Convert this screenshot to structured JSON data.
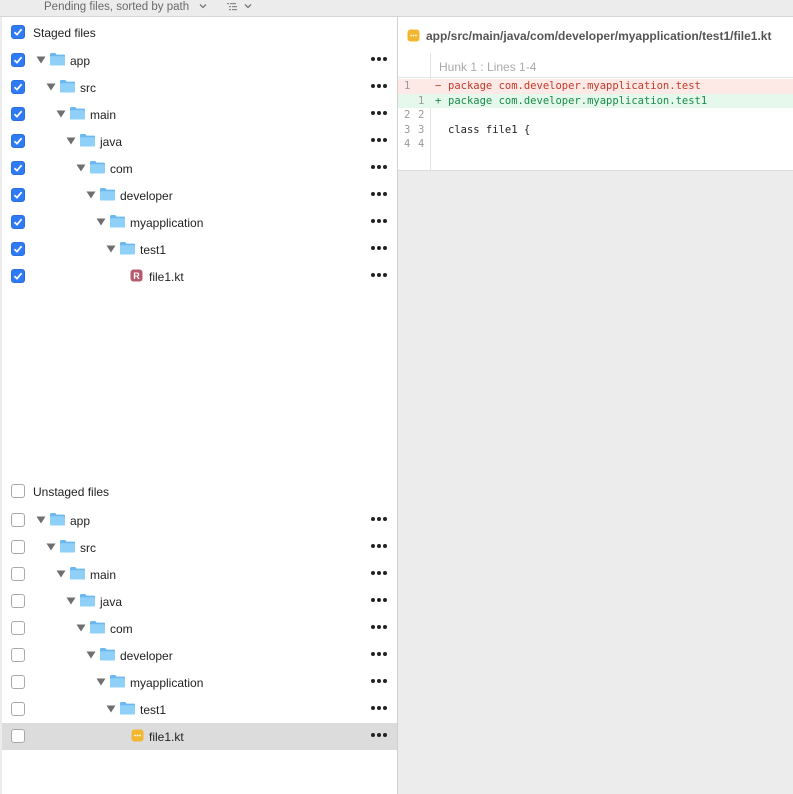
{
  "toolbar": {
    "title": "Pending files, sorted by path"
  },
  "staged": {
    "header": "Staged files",
    "checked": true,
    "rows": [
      {
        "name": "app",
        "type": "folder"
      },
      {
        "name": "src",
        "type": "folder"
      },
      {
        "name": "main",
        "type": "folder"
      },
      {
        "name": "java",
        "type": "folder"
      },
      {
        "name": "com",
        "type": "folder"
      },
      {
        "name": "developer",
        "type": "folder"
      },
      {
        "name": "myapplication",
        "type": "folder"
      },
      {
        "name": "test1",
        "type": "folder"
      },
      {
        "name": "file1.kt",
        "type": "file-renamed",
        "badge": "R"
      }
    ]
  },
  "unstaged": {
    "header": "Unstaged files",
    "checked": false,
    "rows": [
      {
        "name": "app",
        "type": "folder"
      },
      {
        "name": "src",
        "type": "folder"
      },
      {
        "name": "main",
        "type": "folder"
      },
      {
        "name": "java",
        "type": "folder"
      },
      {
        "name": "com",
        "type": "folder"
      },
      {
        "name": "developer",
        "type": "folder"
      },
      {
        "name": "myapplication",
        "type": "folder"
      },
      {
        "name": "test1",
        "type": "folder"
      },
      {
        "name": "file1.kt",
        "type": "file-modified",
        "selected": true
      }
    ]
  },
  "diff": {
    "path": "app/src/main/java/com/developer/myapplication/test1/file1.kt",
    "hunk_label": "Hunk 1 : Lines 1-4",
    "lines": [
      {
        "kind": "del",
        "old": "1",
        "new": "",
        "sign": "−",
        "text": "package com.developer.myapplication.test"
      },
      {
        "kind": "add",
        "old": "",
        "new": "1",
        "sign": "+",
        "text": "package com.developer.myapplication.test1"
      },
      {
        "kind": "ctx",
        "old": "2",
        "new": "2",
        "sign": "",
        "text": ""
      },
      {
        "kind": "ctx",
        "old": "3",
        "new": "3",
        "sign": "",
        "text": "class file1 {"
      },
      {
        "kind": "ctx",
        "old": "4",
        "new": "4",
        "sign": "",
        "text": ""
      }
    ]
  },
  "colors": {
    "checkbox_on": "#2f7bf6",
    "folder": "#7cc4f4",
    "renamed_badge": "#b65a6e",
    "modified_badge": "#f3b62f",
    "deleted_text": "#c23a2a",
    "added_text": "#1a8b4a"
  }
}
